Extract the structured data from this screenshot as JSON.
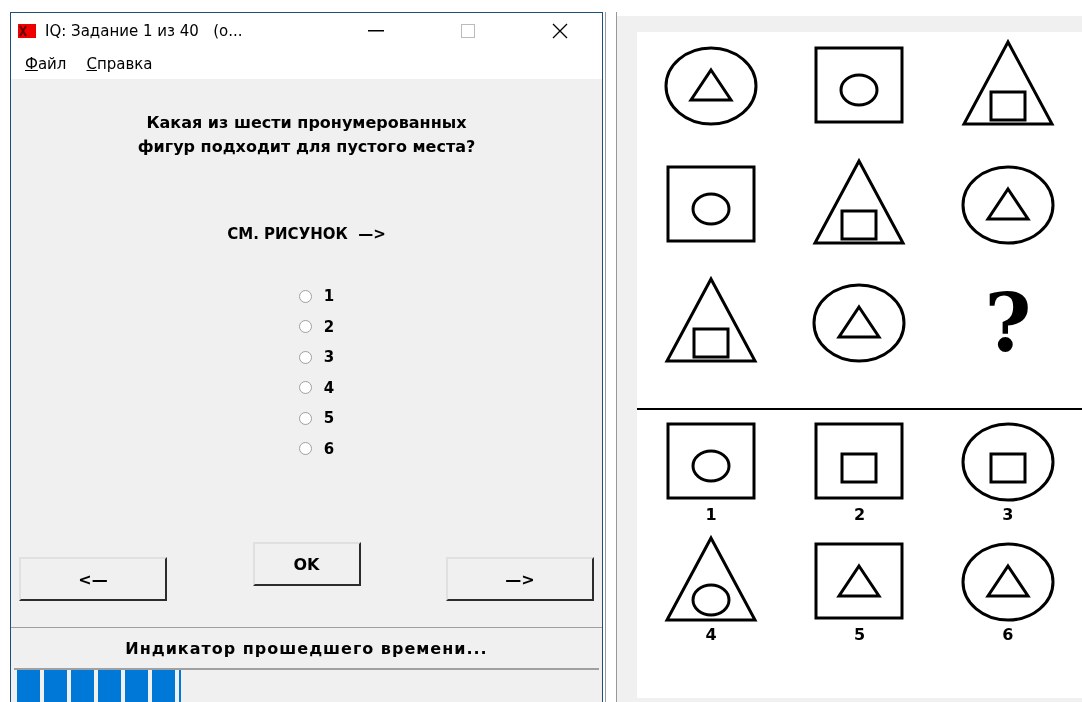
{
  "window": {
    "title": "IQ: Задание 1 из 40   (о..."
  },
  "menu": [
    {
      "label": "Файл"
    },
    {
      "label": "Справка"
    }
  ],
  "question": {
    "lines": [
      "Какая из шести пронумерованных",
      "фигур подходит для пустого места?"
    ],
    "hint": "СМ. РИСУНОК  —>"
  },
  "answers": [
    {
      "label": "1",
      "selected": false
    },
    {
      "label": "2",
      "selected": false
    },
    {
      "label": "3",
      "selected": false
    },
    {
      "label": "4",
      "selected": false
    },
    {
      "label": "5",
      "selected": false
    },
    {
      "label": "6",
      "selected": false
    }
  ],
  "buttons": {
    "back": "<—",
    "ok": "OK",
    "next": "—>"
  },
  "status": {
    "text": "Индикатор прошедшего времени...",
    "level": 0.28
  },
  "puzzle": {
    "grid": [
      {
        "kind": "figure",
        "outer": {
          "kind": "circle"
        },
        "inner": {
          "kind": "triangle"
        }
      },
      {
        "kind": "figure",
        "outer": {
          "kind": "square"
        },
        "inner": {
          "kind": "circle"
        }
      },
      {
        "kind": "figure",
        "outer": {
          "kind": "triangle"
        },
        "inner": {
          "kind": "square"
        }
      },
      {
        "kind": "figure",
        "outer": {
          "kind": "square"
        },
        "inner": {
          "kind": "circle"
        }
      },
      {
        "kind": "figure",
        "outer": {
          "kind": "triangle"
        },
        "inner": {
          "kind": "square"
        }
      },
      {
        "kind": "figure",
        "outer": {
          "kind": "circle"
        },
        "inner": {
          "kind": "triangle"
        }
      },
      {
        "kind": "figure",
        "outer": {
          "kind": "triangle"
        },
        "inner": {
          "kind": "square"
        }
      },
      {
        "kind": "figure",
        "outer": {
          "kind": "circle"
        },
        "inner": {
          "kind": "triangle"
        }
      },
      {
        "kind": "question",
        "text": "?"
      }
    ],
    "options": [
      {
        "outer": {
          "kind": "square"
        },
        "inner": {
          "kind": "circle"
        },
        "label": "1"
      },
      {
        "outer": {
          "kind": "square"
        },
        "inner": {
          "kind": "square"
        },
        "label": "2"
      },
      {
        "outer": {
          "kind": "circle"
        },
        "inner": {
          "kind": "square"
        },
        "label": "3"
      },
      {
        "outer": {
          "kind": "triangle"
        },
        "inner": {
          "kind": "circle"
        },
        "label": "4"
      },
      {
        "outer": {
          "kind": "square"
        },
        "inner": {
          "kind": "triangle"
        },
        "label": "5"
      },
      {
        "outer": {
          "kind": "circle"
        },
        "inner": {
          "kind": "triangle"
        },
        "label": "6"
      }
    ]
  }
}
